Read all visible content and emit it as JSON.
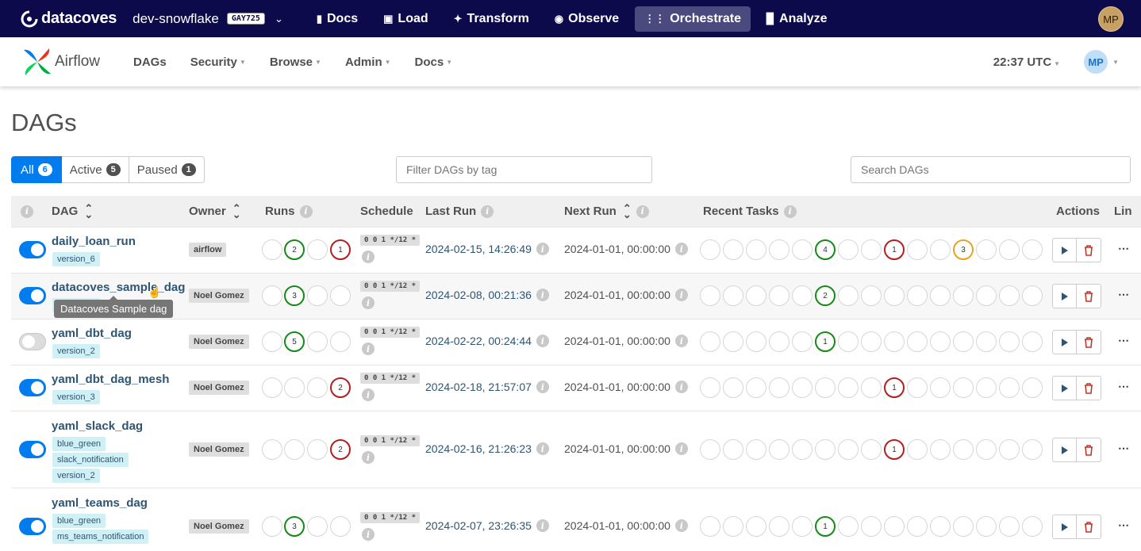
{
  "topbar": {
    "brand": "datacoves",
    "environment": "dev-snowflake",
    "env_badge": "GAY725",
    "nav": [
      {
        "icon": "book-icon",
        "label": "Docs"
      },
      {
        "icon": "load-icon",
        "label": "Load"
      },
      {
        "icon": "transform-icon",
        "label": "Transform"
      },
      {
        "icon": "eye-icon",
        "label": "Observe"
      },
      {
        "icon": "orchestrate-icon",
        "label": "Orchestrate"
      },
      {
        "icon": "bar-chart-icon",
        "label": "Analyze"
      }
    ],
    "active": "Orchestrate",
    "user_initials": "MP"
  },
  "airflow_nav": {
    "logo_text": "Airflow",
    "menu": [
      "DAGs",
      "Security",
      "Browse",
      "Admin",
      "Docs"
    ],
    "clock": "22:37 UTC",
    "user_initials": "MP"
  },
  "page": {
    "title": "DAGs",
    "filters": [
      {
        "label": "All",
        "count": "6"
      },
      {
        "label": "Active",
        "count": "5"
      },
      {
        "label": "Paused",
        "count": "1"
      }
    ],
    "tag_filter_placeholder": "Filter DAGs by tag",
    "search_placeholder": "Search DAGs"
  },
  "table": {
    "headers": {
      "dag": "DAG",
      "owner": "Owner",
      "runs": "Runs",
      "schedule": "Schedule",
      "last_run": "Last Run",
      "next_run": "Next Run",
      "recent_tasks": "Recent Tasks",
      "actions": "Actions",
      "links": "Lin"
    },
    "rows": [
      {
        "name": "daily_loan_run",
        "tags": [
          "version_6"
        ],
        "owner": "airflow",
        "enabled": true,
        "runs": [
          "",
          "2",
          "",
          "1"
        ],
        "schedule": "0 0 1 */12 *",
        "last_run": "2024-02-15, 14:26:49",
        "next_run": "2024-01-01, 00:00:00",
        "recent": [
          "",
          "",
          "",
          "",
          "",
          "4",
          "",
          "",
          "1",
          "",
          "",
          "3",
          "",
          "",
          "",
          ""
        ]
      },
      {
        "name": "datacoves_sample_dag",
        "tags": [
          "version_6"
        ],
        "owner": "Noel Gomez",
        "enabled": true,
        "runs": [
          "",
          "3",
          "",
          ""
        ],
        "schedule": "0 0 1 */12 *",
        "last_run": "2024-02-08, 00:21:36",
        "next_run": "2024-01-01, 00:00:00",
        "recent": [
          "",
          "",
          "",
          "",
          "",
          "2",
          "",
          "",
          "",
          "",
          "",
          "",
          "",
          "",
          "",
          ""
        ]
      },
      {
        "name": "yaml_dbt_dag",
        "tags": [
          "version_2"
        ],
        "owner": "Noel Gomez",
        "enabled": false,
        "runs": [
          "",
          "5",
          "",
          ""
        ],
        "schedule": "0 0 1 */12 *",
        "last_run": "2024-02-22, 00:24:44",
        "next_run": "2024-01-01, 00:00:00",
        "recent": [
          "",
          "",
          "",
          "",
          "",
          "1",
          "",
          "",
          "",
          "",
          "",
          "",
          "",
          "",
          "",
          ""
        ]
      },
      {
        "name": "yaml_dbt_dag_mesh",
        "tags": [
          "version_3"
        ],
        "owner": "Noel Gomez",
        "enabled": true,
        "runs": [
          "",
          "",
          "",
          "2"
        ],
        "schedule": "0 0 1 */12 *",
        "last_run": "2024-02-18, 21:57:07",
        "next_run": "2024-01-01, 00:00:00",
        "recent": [
          "",
          "",
          "",
          "",
          "",
          "",
          "",
          "",
          "1",
          "",
          "",
          "",
          "",
          "",
          "",
          ""
        ]
      },
      {
        "name": "yaml_slack_dag",
        "tags": [
          "blue_green",
          "slack_notification",
          "version_2"
        ],
        "owner": "Noel Gomez",
        "enabled": true,
        "runs": [
          "",
          "",
          "",
          "2"
        ],
        "schedule": "0 0 1 */12 *",
        "last_run": "2024-02-16, 21:26:23",
        "next_run": "2024-01-01, 00:00:00",
        "recent": [
          "",
          "",
          "",
          "",
          "",
          "",
          "",
          "",
          "1",
          "",
          "",
          "",
          "",
          "",
          "",
          ""
        ]
      },
      {
        "name": "yaml_teams_dag",
        "tags": [
          "blue_green",
          "ms_teams_notification"
        ],
        "owner": "Noel Gomez",
        "enabled": true,
        "runs": [
          "",
          "3",
          "",
          ""
        ],
        "schedule": "0 0 1 */12 *",
        "last_run": "2024-02-07, 23:26:35",
        "next_run": "2024-01-01, 00:00:00",
        "recent": [
          "",
          "",
          "",
          "",
          "",
          "1",
          "",
          "",
          "",
          "",
          "",
          "",
          "",
          "",
          "",
          ""
        ]
      }
    ]
  },
  "tooltip": "Datacoves Sample dag",
  "colors": {
    "success": "#168a16",
    "failed": "#b31e1e",
    "upstream_failed": "#e4a521",
    "primary": "#017cee",
    "topbar": "#0c0a4b"
  }
}
